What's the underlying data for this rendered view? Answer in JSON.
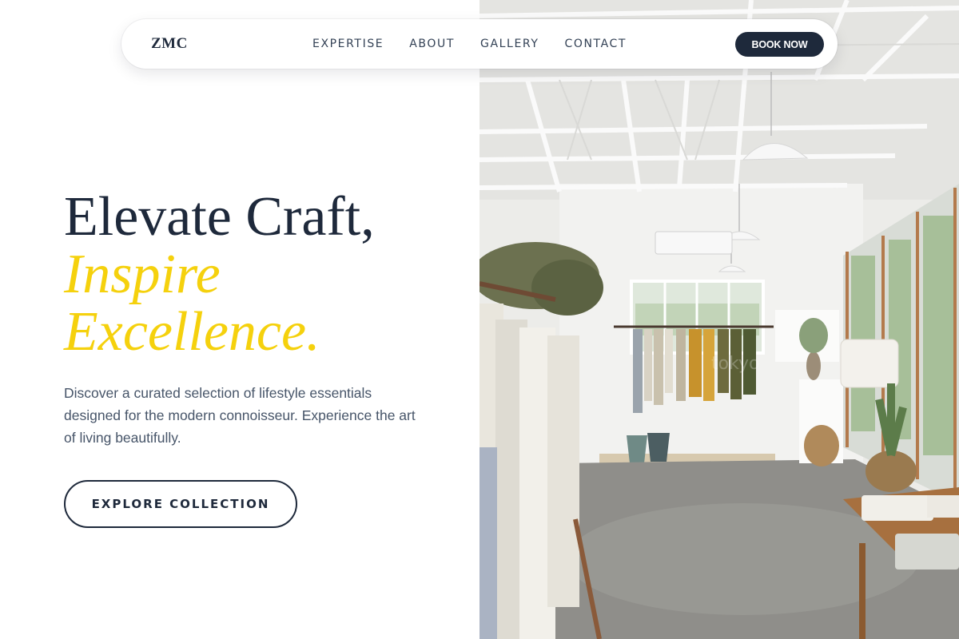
{
  "nav": {
    "logo": "ZMC",
    "links": [
      "EXPERTISE",
      "ABOUT",
      "GALLERY",
      "CONTACT"
    ],
    "cta": "BOOK NOW"
  },
  "hero": {
    "headline_line1": "Elevate Craft,",
    "headline_line2": "Inspire",
    "headline_line3": "Excellence.",
    "description": "Discover a curated selection of lifestyle essentials designed for the modern connoisseur. Experience the art of living beautifully.",
    "cta_label": "EXPLORE COLLECTION"
  },
  "image": {
    "subject": "boutique-clothing-store-interior"
  },
  "colors": {
    "primary": "#1e293b",
    "accent": "#f5d10d",
    "body_text": "#475569",
    "background": "#ffffff"
  }
}
